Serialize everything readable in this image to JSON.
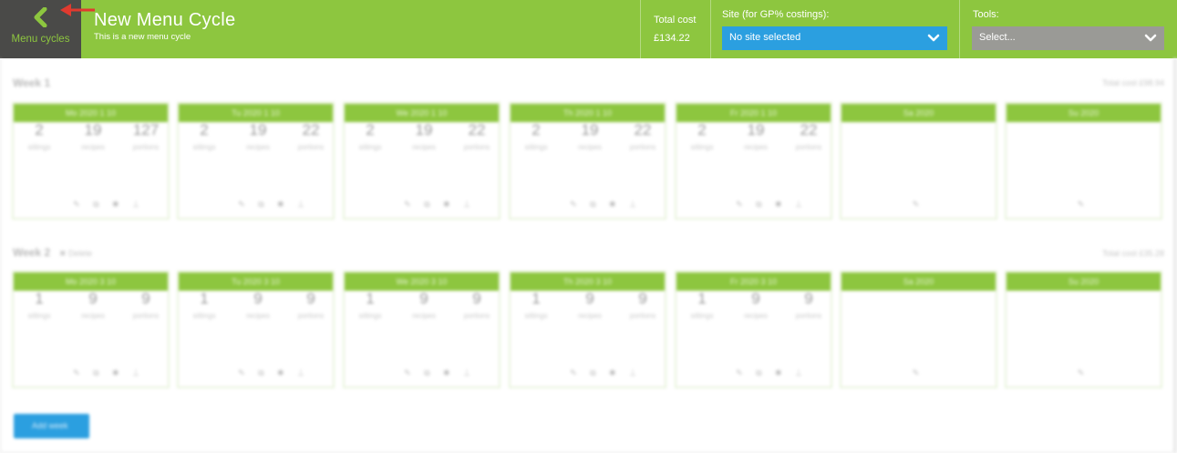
{
  "header": {
    "back_label": "Menu cycles",
    "title": "New Menu Cycle",
    "subtitle": "This is a new menu cycle",
    "total_cost_label": "Total cost",
    "total_cost_value": "£134.22",
    "site_label": "Site (for GP% costings):",
    "site_value": "No site selected",
    "tools_label": "Tools:",
    "tools_value": "Select..."
  },
  "colors": {
    "brand_green": "#8dc63f",
    "dark_back": "#4a4a48",
    "site_blue": "#2b9fe0",
    "tools_grey": "#9a9a96",
    "annotation_arrow": "#e03a2f"
  },
  "weeks": [
    {
      "title": "Week 1",
      "tag": "",
      "cost": "Total cost £98.94",
      "days": [
        {
          "label": "Mo 2020  1  10",
          "s1": "2",
          "s2": "19",
          "s3": "127",
          "c1": "sittings",
          "c2": "recipes",
          "c3": "portions"
        },
        {
          "label": "Tu 2020  1  10",
          "s1": "2",
          "s2": "19",
          "s3": "22",
          "c1": "sittings",
          "c2": "recipes",
          "c3": "portions"
        },
        {
          "label": "We 2020  1  10",
          "s1": "2",
          "s2": "19",
          "s3": "22",
          "c1": "sittings",
          "c2": "recipes",
          "c3": "portions"
        },
        {
          "label": "Th 2020  1  10",
          "s1": "2",
          "s2": "19",
          "s3": "22",
          "c1": "sittings",
          "c2": "recipes",
          "c3": "portions"
        },
        {
          "label": "Fr 2020  1  10",
          "s1": "2",
          "s2": "19",
          "s3": "22",
          "c1": "sittings",
          "c2": "recipes",
          "c3": "portions"
        },
        {
          "label": "Sa 2020",
          "s1": "",
          "s2": "",
          "s3": "",
          "c1": "",
          "c2": "",
          "c3": ""
        },
        {
          "label": "Su 2020",
          "s1": "",
          "s2": "",
          "s3": "",
          "c1": "",
          "c2": "",
          "c3": ""
        }
      ]
    },
    {
      "title": "Week 2",
      "tag": "✖ Delete",
      "cost": "Total cost £35.28",
      "days": [
        {
          "label": "Mo 2020  3  10",
          "s1": "1",
          "s2": "9",
          "s3": "9",
          "c1": "sittings",
          "c2": "recipes",
          "c3": "portions"
        },
        {
          "label": "Tu 2020  3  10",
          "s1": "1",
          "s2": "9",
          "s3": "9",
          "c1": "sittings",
          "c2": "recipes",
          "c3": "portions"
        },
        {
          "label": "We 2020  3  10",
          "s1": "1",
          "s2": "9",
          "s3": "9",
          "c1": "sittings",
          "c2": "recipes",
          "c3": "portions"
        },
        {
          "label": "Th 2020  3  10",
          "s1": "1",
          "s2": "9",
          "s3": "9",
          "c1": "sittings",
          "c2": "recipes",
          "c3": "portions"
        },
        {
          "label": "Fr 2020  3  10",
          "s1": "1",
          "s2": "9",
          "s3": "9",
          "c1": "sittings",
          "c2": "recipes",
          "c3": "portions"
        },
        {
          "label": "Sa 2020",
          "s1": "",
          "s2": "",
          "s3": "",
          "c1": "",
          "c2": "",
          "c3": ""
        },
        {
          "label": "Su 2020",
          "s1": "",
          "s2": "",
          "s3": "",
          "c1": "",
          "c2": "",
          "c3": ""
        }
      ]
    }
  ],
  "icons_full": "✎ ⧉ ✱ ⊥",
  "icons_single": "✎",
  "add_week_label": "Add week"
}
